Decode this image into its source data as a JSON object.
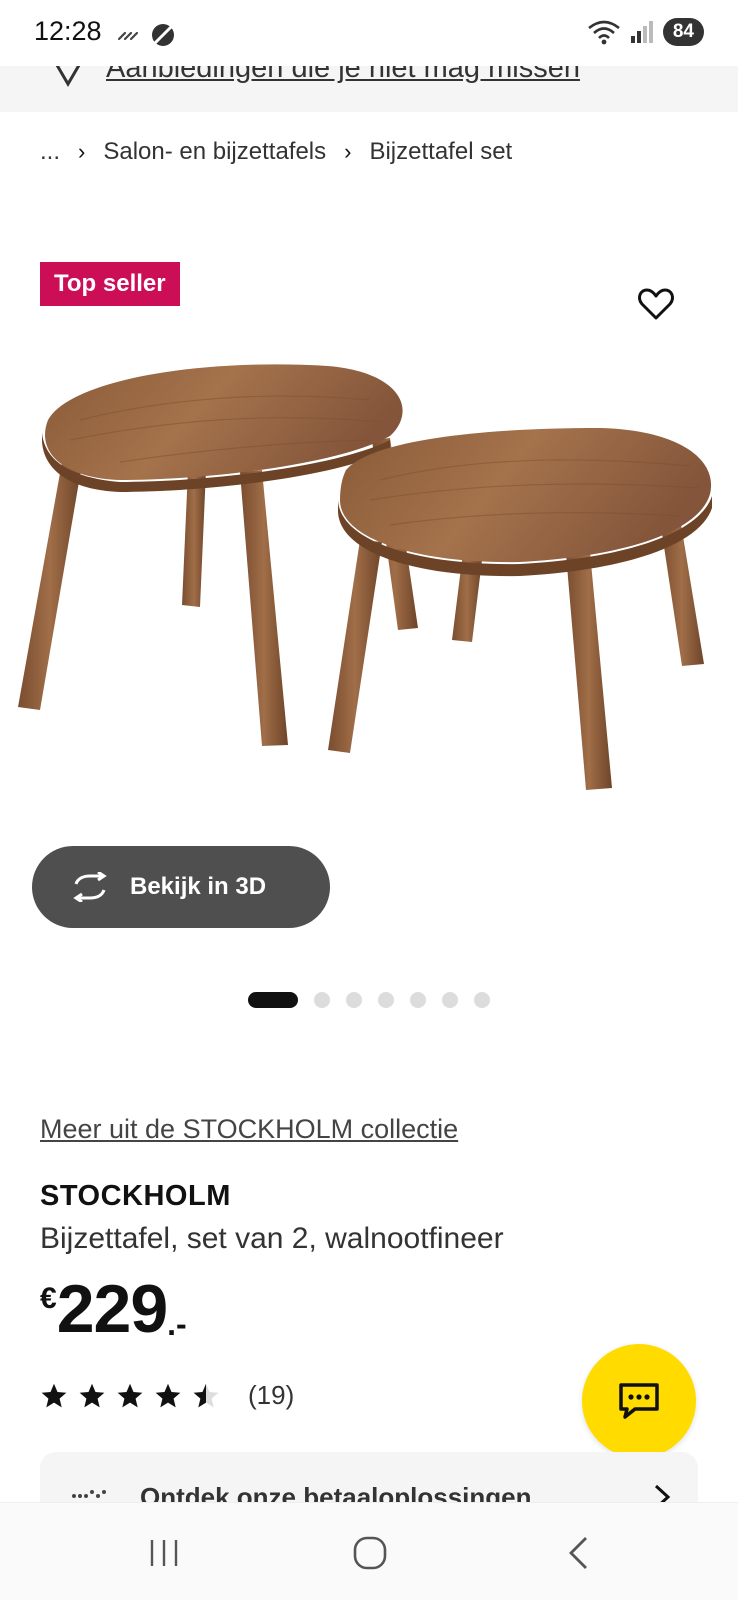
{
  "status_bar": {
    "time": "12:28",
    "battery": "84",
    "wifi_badge": "6"
  },
  "promo": {
    "text": "Aanbiedingen die je niet mag missen"
  },
  "breadcrumb": {
    "ellipsis": "...",
    "items": [
      "Salon- en bijzettafels",
      "Bijzettafel set"
    ]
  },
  "product": {
    "badge": "Top seller",
    "view_3d_label": "Bekijk in 3D",
    "image_count": 7,
    "active_image_index": 0,
    "collection_link": "Meer uit de STOCKHOLM collectie",
    "name": "STOCKHOLM",
    "description": "Bijzettafel, set van 2, walnootfineer",
    "price_currency": "€",
    "price_amount": "229",
    "price_decimals": ".-",
    "rating": 4.5,
    "rating_max": 5,
    "review_count": "(19)"
  },
  "payment": {
    "text": "Ontdek onze betaaloplossingen"
  },
  "icons": {
    "heart": "heart-icon",
    "rotate": "rotate-3d-icon",
    "chat": "chat-icon",
    "chevron": "chevron-right-icon"
  },
  "colors": {
    "badge": "#cc0e57",
    "chat_fab": "#ffdb00",
    "button_3d": "#4f4f4f"
  }
}
